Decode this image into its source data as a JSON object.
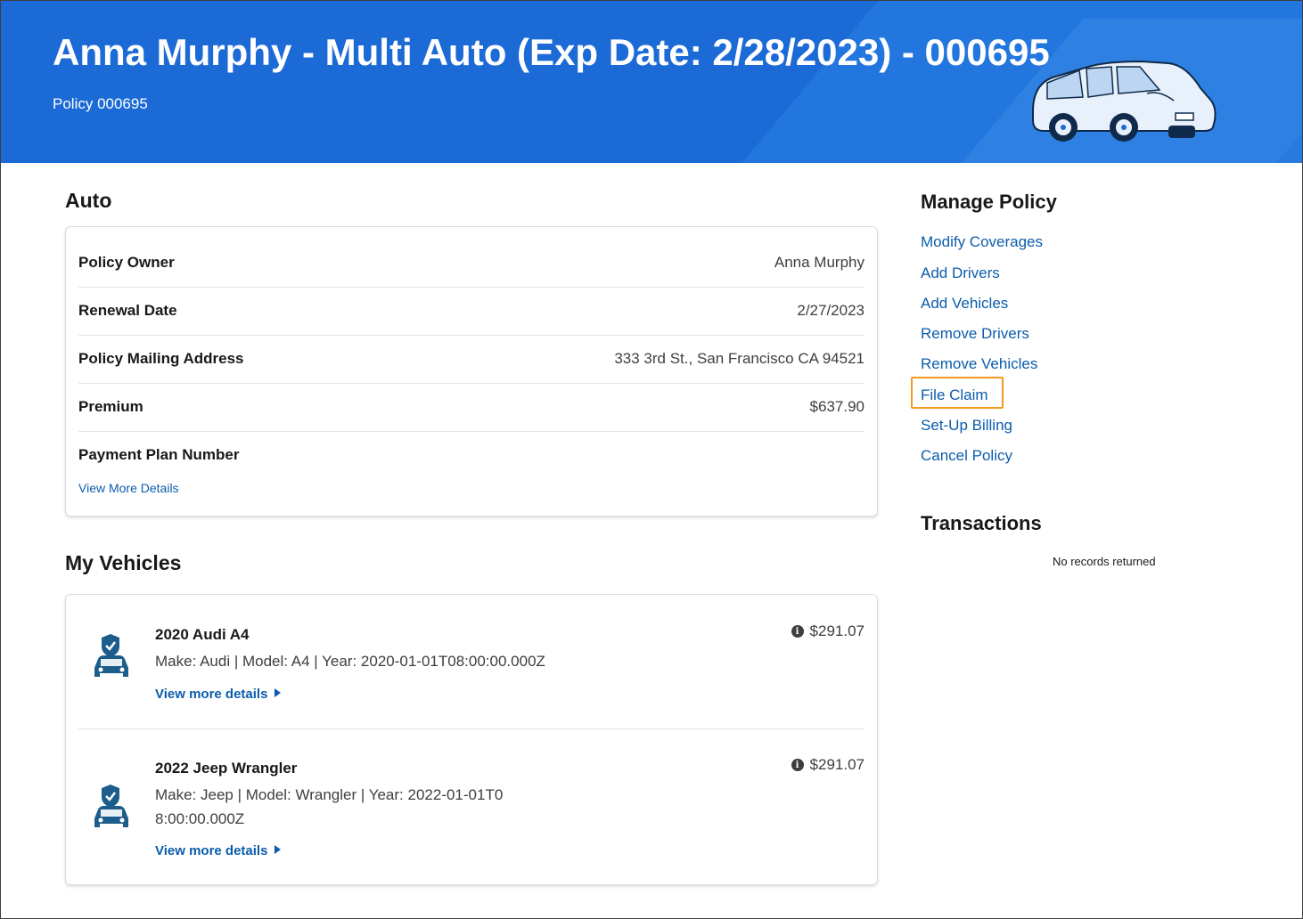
{
  "header": {
    "title": "Anna Murphy - Multi Auto (Exp Date: 2/28/2023) - 000695",
    "subtitle": "Policy 000695"
  },
  "auto": {
    "section_title": "Auto",
    "rows": [
      {
        "label": "Policy Owner",
        "value": "Anna Murphy"
      },
      {
        "label": "Renewal Date",
        "value": "2/27/2023"
      },
      {
        "label": "Policy Mailing Address",
        "value": "333 3rd St., San Francisco CA 94521"
      },
      {
        "label": "Premium",
        "value": "$637.90"
      },
      {
        "label": "Payment Plan Number",
        "value": ""
      }
    ],
    "view_more": "View More Details"
  },
  "vehicles": {
    "section_title": "My Vehicles",
    "items": [
      {
        "name": "2020 Audi A4",
        "description": "Make: Audi | Model: A4 | Year: 2020-01-01T08:00:00.000Z",
        "price": "$291.07",
        "more": "View more details"
      },
      {
        "name": "2022 Jeep Wrangler",
        "description": "Make: Jeep | Model: Wrangler | Year: 2022-01-01T08:00:00.000Z",
        "price": "$291.07",
        "more": "View more details"
      }
    ]
  },
  "manage_policy": {
    "title": "Manage Policy",
    "links": [
      "Modify Coverages",
      "Add Drivers",
      "Add Vehicles",
      "Remove Drivers",
      "Remove Vehicles",
      "File Claim",
      "Set-Up Billing",
      "Cancel Policy"
    ],
    "highlighted": "File Claim"
  },
  "transactions": {
    "title": "Transactions",
    "empty_text": "No records returned"
  },
  "colors": {
    "banner": "#1b6ad6",
    "link": "#0b5cab",
    "highlight": "#f39a1e",
    "vehicle_icon": "#1d5d8c"
  },
  "icons": {
    "vehicle": "car-shield-icon",
    "price_info": "info-icon",
    "more_arrow": "triangle-right-icon"
  }
}
